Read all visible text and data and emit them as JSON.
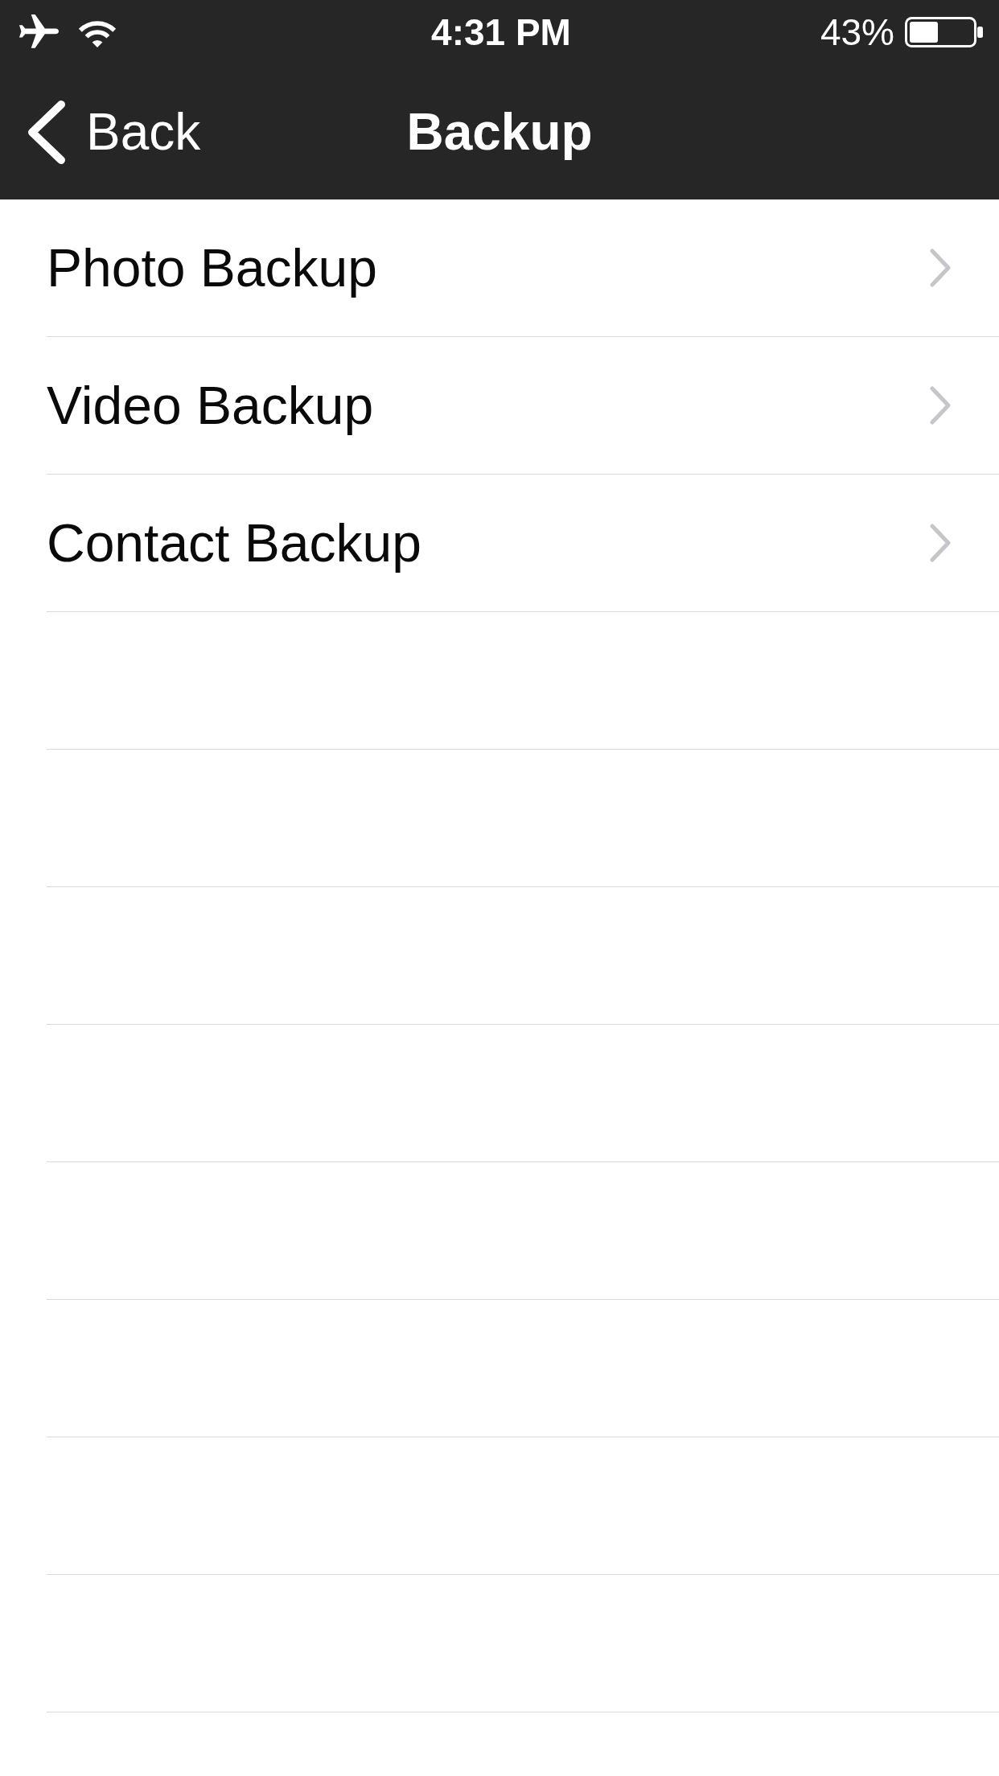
{
  "status_bar": {
    "airplane_mode": true,
    "wifi": true,
    "time": "4:31 PM",
    "battery_percent": "43%"
  },
  "nav_bar": {
    "back_label": "Back",
    "title": "Backup"
  },
  "items": [
    {
      "label": "Photo Backup"
    },
    {
      "label": "Video Backup"
    },
    {
      "label": "Contact Backup"
    }
  ]
}
